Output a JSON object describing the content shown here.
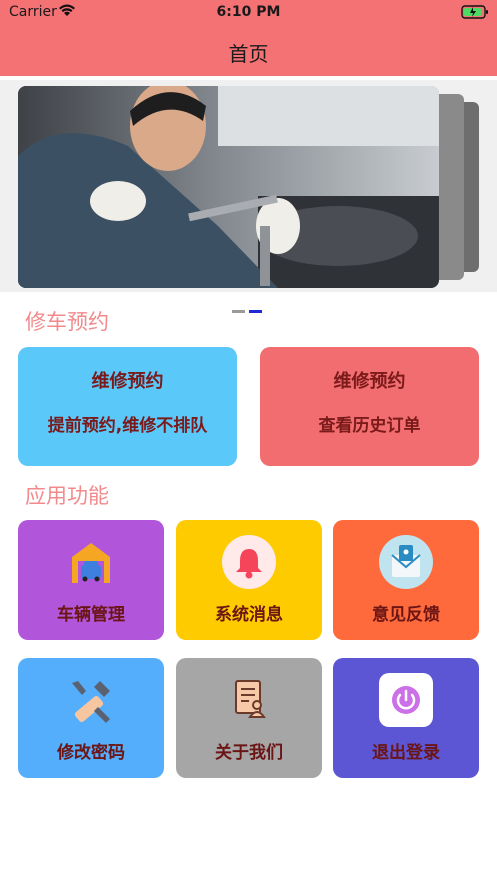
{
  "status": {
    "carrier": "Carrier",
    "time": "6:10 PM"
  },
  "nav": {
    "title": "首页"
  },
  "carousel": {
    "slides": 2,
    "active_index": 1
  },
  "sections": {
    "booking": "修车预约",
    "apps": "应用功能"
  },
  "booking_cards": [
    {
      "title": "维修预约",
      "subtitle": "提前预约,维修不排队",
      "color": "#5bc8fa"
    },
    {
      "title": "维修预约",
      "subtitle": "查看历史订单",
      "color": "#f26d6f"
    }
  ],
  "functions": [
    {
      "label": "车辆管理",
      "icon": "garage-icon",
      "color": "#b155db"
    },
    {
      "label": "系统消息",
      "icon": "bell-icon",
      "color": "#fecb00"
    },
    {
      "label": "意见反馈",
      "icon": "mail-icon",
      "color": "#ff6a3d"
    },
    {
      "label": "修改密码",
      "icon": "wrench-icon",
      "color": "#54aefc"
    },
    {
      "label": "关于我们",
      "icon": "document-person-icon",
      "color": "#a6a6a6"
    },
    {
      "label": "退出登录",
      "icon": "power-icon",
      "color": "#5c55d4"
    }
  ]
}
